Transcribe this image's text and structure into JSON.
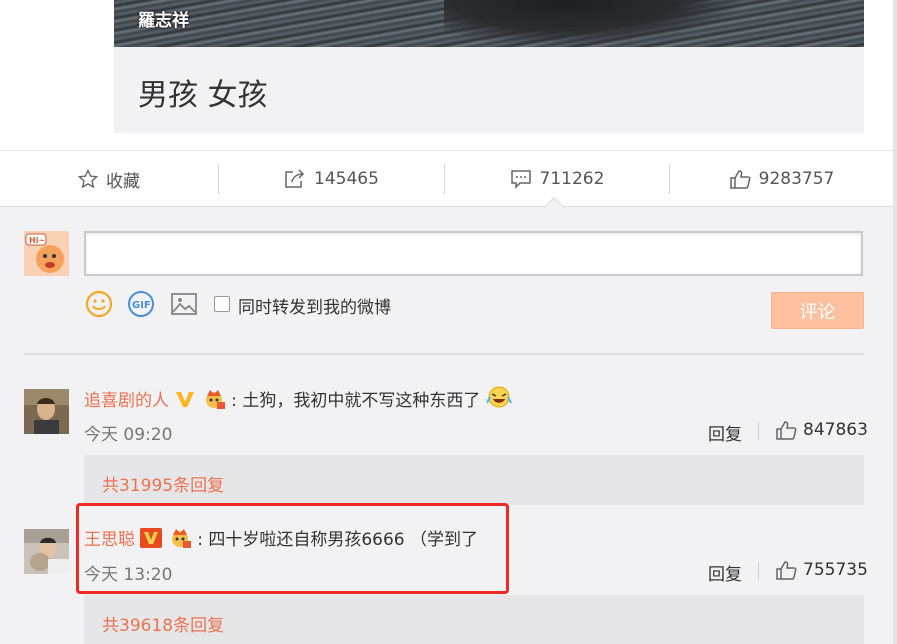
{
  "card": {
    "image_caption": "羅志祥",
    "title": "男孩 女孩"
  },
  "actions": {
    "favorite_label": "收藏",
    "repost_count": "145465",
    "comment_count": "711262",
    "like_count": "9283757"
  },
  "composer": {
    "input_value": "",
    "repost_label": "同时转发到我的微博",
    "submit_label": "评论",
    "tools": [
      "emoji-icon",
      "gif-icon",
      "image-icon"
    ]
  },
  "comments": [
    {
      "name": "追喜剧的人",
      "separator": ":",
      "text": "土狗，我初中就不写这种东西了",
      "time": "今天 09:20",
      "reply_label": "回复",
      "likes": "847863",
      "more_replies": "共31995条回复",
      "badge": "yellow-v"
    },
    {
      "name": "王思聪",
      "separator": ":",
      "text": "四十岁啦还自称男孩6666 （学到了",
      "time": "今天 13:20",
      "reply_label": "回复",
      "likes": "755735",
      "more_replies": "共39618条回复",
      "badge": "red-v"
    }
  ],
  "colors": {
    "accent": "#eb7350",
    "submit": "#ffc09f",
    "highlight": "#ee2a24",
    "panel": "#f2f2f5"
  }
}
